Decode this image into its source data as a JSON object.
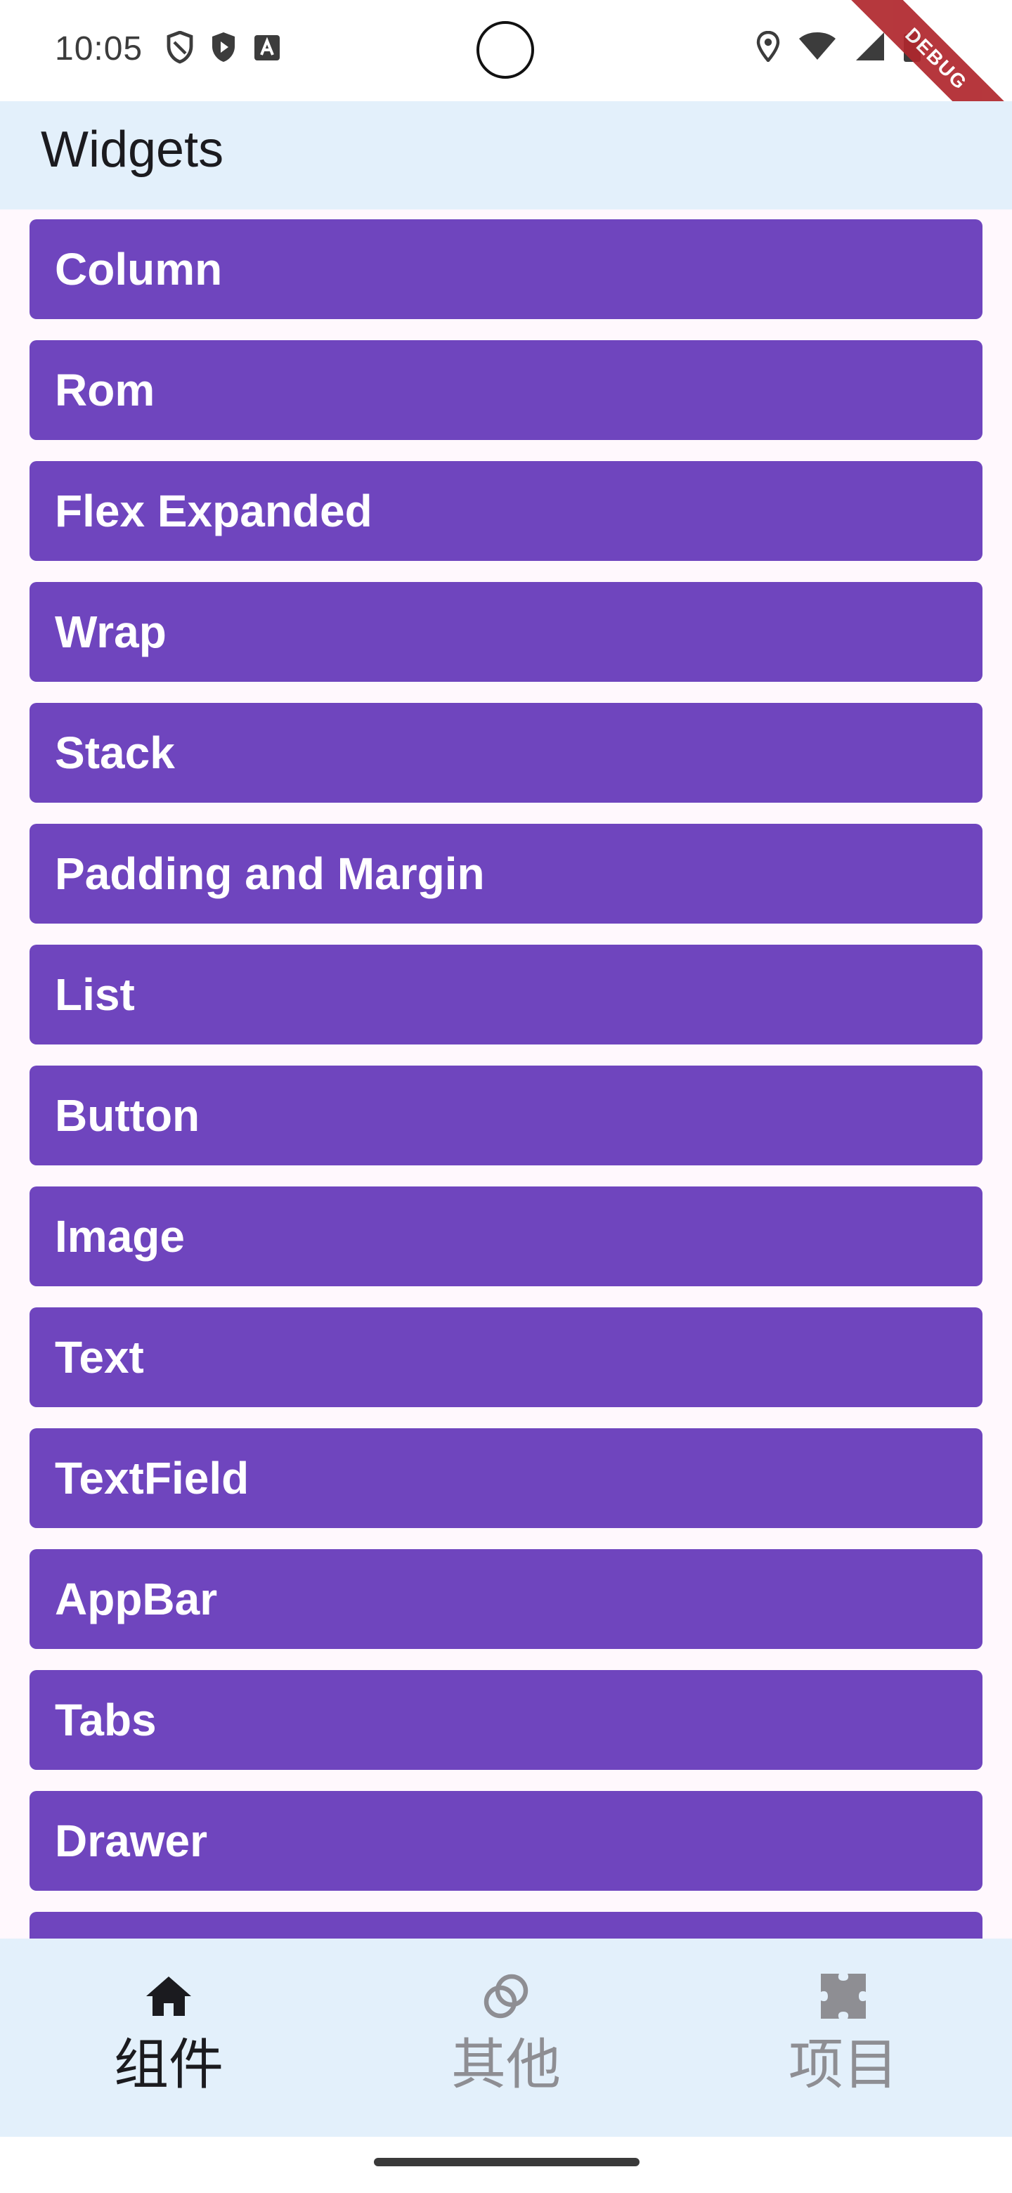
{
  "status_bar": {
    "time": "10:05",
    "debug_label": "DEBUG",
    "icons": [
      "shield-outline-icon",
      "shield-play-icon",
      "text-a-icon",
      "location-icon",
      "wifi-icon",
      "cell-signal-icon",
      "battery-icon"
    ]
  },
  "app_bar": {
    "title": "Widgets"
  },
  "list": {
    "items": [
      {
        "label": "Column"
      },
      {
        "label": "Rom"
      },
      {
        "label": "Flex Expanded"
      },
      {
        "label": "Wrap"
      },
      {
        "label": "Stack"
      },
      {
        "label": "Padding and Margin"
      },
      {
        "label": "List"
      },
      {
        "label": "Button"
      },
      {
        "label": "Image"
      },
      {
        "label": "Text"
      },
      {
        "label": "TextField"
      },
      {
        "label": "AppBar"
      },
      {
        "label": "Tabs"
      },
      {
        "label": "Drawer"
      },
      {
        "label": ""
      }
    ]
  },
  "bottom_nav": {
    "items": [
      {
        "label": "组件",
        "icon": "home-icon",
        "active": true
      },
      {
        "label": "其他",
        "icon": "rings-icon",
        "active": false
      },
      {
        "label": "项目",
        "icon": "puzzle-icon",
        "active": false
      }
    ]
  },
  "colors": {
    "item_background": "#6F45BE",
    "app_bar_background": "#E3F0FB",
    "nav_active": "#1B1B1F",
    "nav_inactive": "#8E8E93"
  }
}
